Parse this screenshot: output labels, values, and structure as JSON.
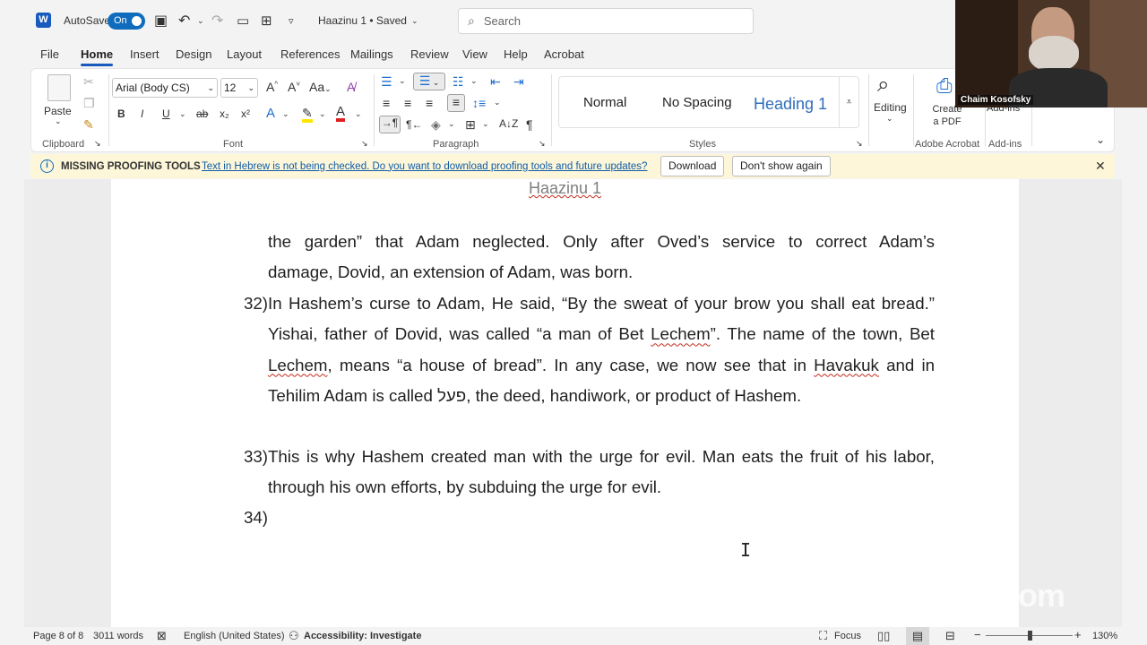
{
  "titlebar": {
    "app_logo": "W",
    "autosave_label": "AutoSave",
    "autosave_state": "On",
    "doc_title": "Haazinu 1 • Saved",
    "search_placeholder": "Search"
  },
  "menu": [
    "File",
    "Home",
    "Insert",
    "Design",
    "Layout",
    "References",
    "Mailings",
    "Review",
    "View",
    "Help",
    "Acrobat"
  ],
  "ribbon": {
    "clipboard": {
      "paste": "Paste",
      "label": "Clipboard"
    },
    "font": {
      "name": "Arial (Body CS)",
      "size": "12",
      "label": "Font",
      "bold": "B",
      "italic": "I",
      "underline": "U",
      "strike": "ab",
      "sub": "x₂",
      "sup": "x²",
      "case": "Aa",
      "grow": "A^",
      "shrink": "A˅"
    },
    "paragraph": {
      "label": "Paragraph"
    },
    "styles": {
      "items": [
        "Normal",
        "No Spacing",
        "Heading 1"
      ],
      "label": "Styles"
    },
    "editing": "Editing",
    "acrobat": {
      "create": "Create a PDF",
      "label": "Adobe Acrobat"
    },
    "addins": {
      "button": "Add-ins",
      "label": "Add-ins"
    }
  },
  "notification": {
    "title": "MISSING PROOFING TOOLS",
    "message": "Text in Hebrew is not being checked. Do you want to download proofing tools and future updates?",
    "download": "Download",
    "dismiss": "Don't show again"
  },
  "document": {
    "header": "Haazinu 1",
    "cont_line1": "the garden” that Adam neglected.  Only after Oved’s service to correct Adam’s",
    "cont_line2": "damage, Dovid, an extension of Adam, was born.",
    "item32_num": "32)",
    "item32_a": "In Hashem’s curse to Adam, He said, “By the sweat of your brow you shall eat bread.”  Yishai, father of Dovid, was called “a man of Bet ",
    "item32_lechem1": "Lechem",
    "item32_b": "”.  The name of the town, Bet ",
    "item32_lechem2": "Lechem",
    "item32_c": ", means “a house of bread”.  In any case, we now see that in ",
    "item32_havakuk": "Havakuk",
    "item32_d": " and in Tehilim Adam is called פעל, the deed, handiwork, or product of Hashem.",
    "item33_num": "33)",
    "item33": "This is why Hashem created man with the urge for evil.  Man eats the fruit of his labor, through his own efforts, by subduing the urge for evil.",
    "item34_num": "34)"
  },
  "statusbar": {
    "page": "Page 8 of 8",
    "words": "3011 words",
    "language": "English (United States)",
    "accessibility": "Accessibility: Investigate",
    "focus": "Focus",
    "zoom": "130%"
  },
  "zoom_overlay": {
    "participant": "Chaim Kosofsky",
    "watermark": "zoom"
  }
}
